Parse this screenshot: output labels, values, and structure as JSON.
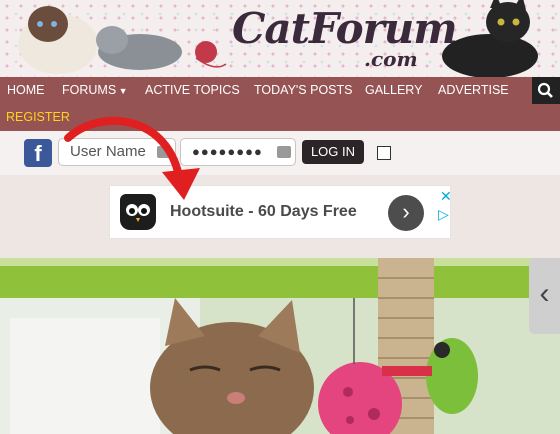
{
  "header": {
    "logo_main": "CatForum",
    "logo_sub": ".com"
  },
  "nav": {
    "items": [
      "HOME",
      "FORUMS",
      "ACTIVE TOPICS",
      "TODAY'S POSTS",
      "GALLERY",
      "ADVERTISE"
    ],
    "register": "REGISTER"
  },
  "login": {
    "facebook_letter": "f",
    "username_placeholder": "User Name",
    "password_mask": "●●●●●●●●",
    "login_label": "LOG IN"
  },
  "ad": {
    "text": "Hootsuite - 60 Days Free",
    "next_glyph": "›",
    "close_glyph": "✕",
    "adchoice_glyph": "▷"
  },
  "slider": {
    "prev_glyph": "‹"
  },
  "colors": {
    "nav_bg": "#955353",
    "register": "#ffd21f",
    "facebook": "#3b5998",
    "annotation_arrow": "#e02020",
    "ad_accent": "#00aadd"
  }
}
